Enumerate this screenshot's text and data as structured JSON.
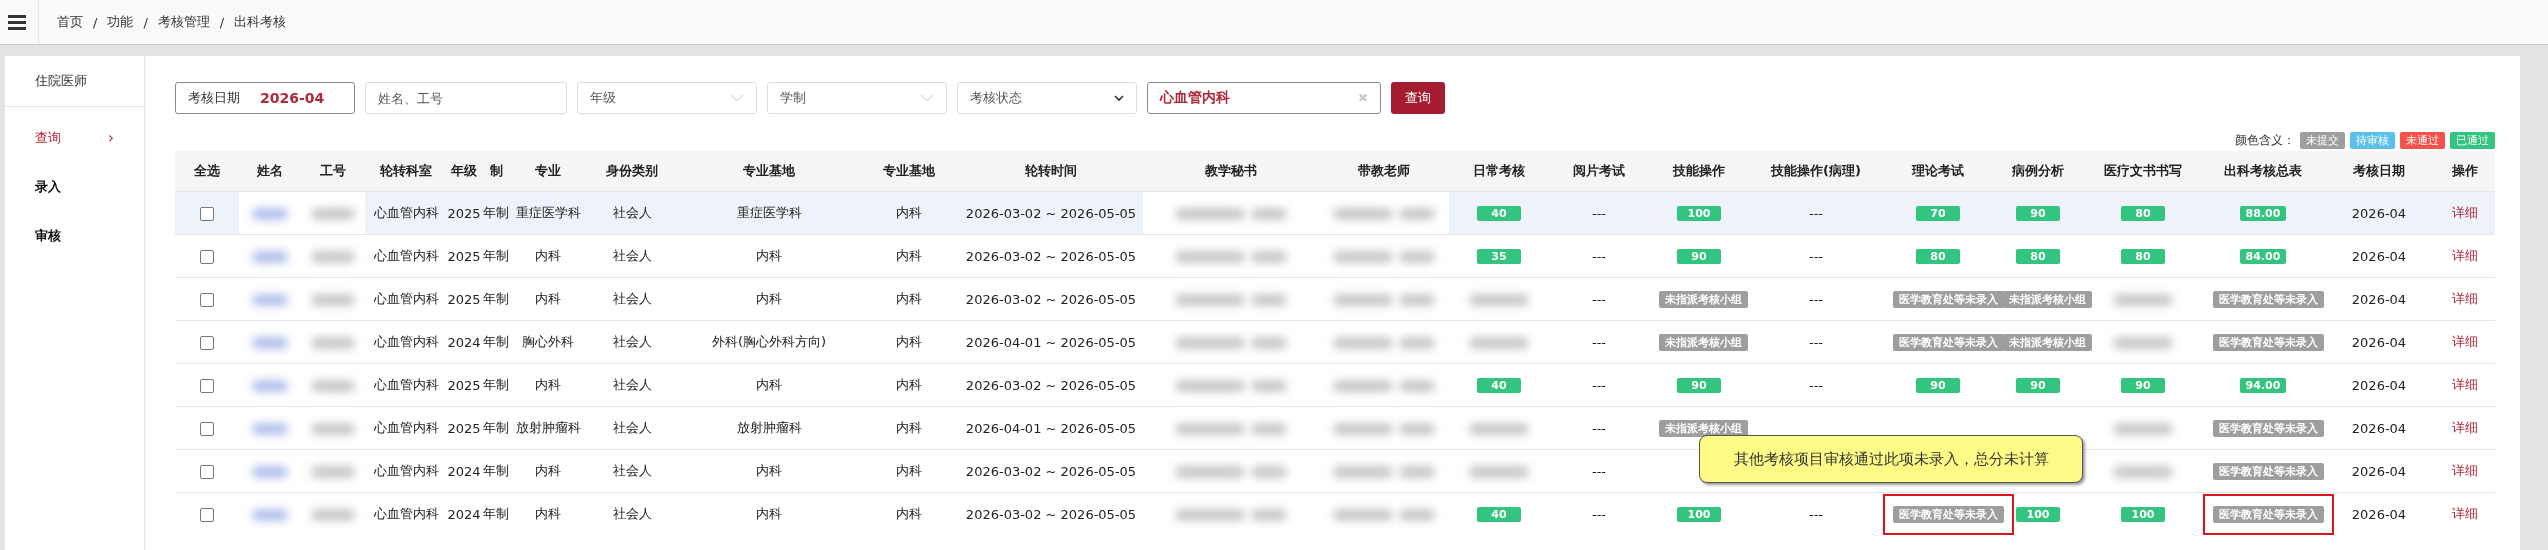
{
  "breadcrumb": {
    "items": [
      "首页",
      "功能",
      "考核管理",
      "出科考核"
    ],
    "separator": "/"
  },
  "sidebar": {
    "title": "住院医师",
    "items": [
      {
        "label": "查询",
        "selected": true,
        "arrow": "›"
      },
      {
        "label": "录入",
        "selected": false
      },
      {
        "label": "审核",
        "selected": false
      }
    ]
  },
  "filters": {
    "date": {
      "label": "考核日期",
      "value": "2026-04"
    },
    "name": {
      "placeholder": "姓名、工号"
    },
    "grade": {
      "placeholder": "年级"
    },
    "system": {
      "placeholder": "学制"
    },
    "status": {
      "placeholder": "考核状态"
    },
    "dept": {
      "value": "心血管内科",
      "clear": "✖"
    },
    "button": "查询"
  },
  "legend": {
    "label": "颜色含义：",
    "items": [
      {
        "label": "未提交",
        "color": "#9e9e9e"
      },
      {
        "label": "待审核",
        "color": "#5bc0eb"
      },
      {
        "label": "未通过",
        "color": "#f5534b"
      },
      {
        "label": "已通过",
        "color": "#33c47f"
      }
    ]
  },
  "table": {
    "columns": [
      "全选",
      "姓名",
      "工号",
      "轮转科室",
      "年级",
      "制",
      "专业",
      "身份类别",
      "专业基地",
      "专业基地",
      "轮转时间",
      "教学秘书",
      "带教老师",
      "日常考核",
      "阅片考试",
      "技能操作",
      "技能操作(病理)",
      "理论考试",
      "病例分析",
      "医疗文书书写",
      "出科考核总表",
      "考核日期",
      "操作"
    ],
    "rows": [
      {
        "hovered": true,
        "checked": false,
        "dept": "心血管内科",
        "grade": "2025",
        "system": "年制",
        "major": "重症医学科",
        "identity": "社会人",
        "base": "重症医学科",
        "base2": "内科",
        "period": "2026-03-02 ~ 2026-05-05",
        "scores": [
          {
            "kind": "badge",
            "text": "40",
            "color": "#33c47f",
            "outlined": false
          },
          {
            "kind": "dash",
            "text": "---"
          },
          {
            "kind": "badge",
            "text": "100",
            "color": "#33c47f",
            "outlined": false
          },
          {
            "kind": "dash",
            "text": "---"
          },
          {
            "kind": "badge",
            "text": "70",
            "color": "#33c47f",
            "outlined": false
          },
          {
            "kind": "badge",
            "text": "90",
            "color": "#33c47f",
            "outlined": false
          },
          {
            "kind": "badge",
            "text": "80",
            "color": "#33c47f",
            "outlined": false
          },
          {
            "kind": "badge",
            "text": "88.00",
            "color": "#33c47f",
            "outlined": false
          }
        ],
        "date": "2026-04",
        "action": "详细"
      },
      {
        "hovered": false,
        "checked": false,
        "dept": "心血管内科",
        "grade": "2025",
        "system": "年制",
        "major": "内科",
        "identity": "社会人",
        "base": "内科",
        "base2": "内科",
        "period": "2026-03-02 ~ 2026-05-05",
        "scores": [
          {
            "kind": "badge",
            "text": "35",
            "color": "#33c47f",
            "outlined": false
          },
          {
            "kind": "dash",
            "text": "---"
          },
          {
            "kind": "badge",
            "text": "90",
            "color": "#33c47f",
            "outlined": false
          },
          {
            "kind": "dash",
            "text": "---"
          },
          {
            "kind": "badge",
            "text": "80",
            "color": "#33c47f",
            "outlined": false
          },
          {
            "kind": "badge",
            "text": "80",
            "color": "#33c47f",
            "outlined": false
          },
          {
            "kind": "badge",
            "text": "80",
            "color": "#33c47f",
            "outlined": false
          },
          {
            "kind": "badge",
            "text": "84.00",
            "color": "#33c47f",
            "outlined": false
          }
        ],
        "date": "2026-04",
        "action": "详细"
      },
      {
        "hovered": false,
        "checked": false,
        "dept": "心血管内科",
        "grade": "2025",
        "system": "年制",
        "major": "内科",
        "identity": "社会人",
        "base": "内科",
        "base2": "内科",
        "period": "2026-03-02 ~ 2026-05-05",
        "scores": [
          {
            "kind": "blurred"
          },
          {
            "kind": "dash",
            "text": "---"
          },
          {
            "kind": "badge",
            "text": "未指派考核小组",
            "color": "#9e9e9e",
            "outlined": false
          },
          {
            "kind": "dash",
            "text": "---"
          },
          {
            "kind": "badge",
            "text": "医学教育处等未录入",
            "color": "#9e9e9e",
            "outlined": false
          },
          {
            "kind": "badge",
            "text": "未指派考核小组",
            "color": "#9e9e9e",
            "outlined": false
          },
          {
            "kind": "blurred"
          },
          {
            "kind": "badge",
            "text": "医学教育处等未录入",
            "color": "#9e9e9e",
            "outlined": false
          }
        ],
        "date": "2026-04",
        "action": "详细"
      },
      {
        "hovered": false,
        "checked": false,
        "dept": "心血管内科",
        "grade": "2024",
        "system": "年制",
        "major": "胸心外科",
        "identity": "社会人",
        "base": "外科(胸心外科方向)",
        "base2": "内科",
        "period": "2026-04-01 ~ 2026-05-05",
        "scores": [
          {
            "kind": "blurred"
          },
          {
            "kind": "dash",
            "text": "---"
          },
          {
            "kind": "badge",
            "text": "未指派考核小组",
            "color": "#9e9e9e",
            "outlined": false
          },
          {
            "kind": "dash",
            "text": "---"
          },
          {
            "kind": "badge",
            "text": "医学教育处等未录入",
            "color": "#9e9e9e",
            "outlined": false
          },
          {
            "kind": "badge",
            "text": "未指派考核小组",
            "color": "#9e9e9e",
            "outlined": false
          },
          {
            "kind": "blurred"
          },
          {
            "kind": "badge",
            "text": "医学教育处等未录入",
            "color": "#9e9e9e",
            "outlined": false
          }
        ],
        "date": "2026-04",
        "action": "详细"
      },
      {
        "hovered": false,
        "checked": false,
        "dept": "心血管内科",
        "grade": "2025",
        "system": "年制",
        "major": "内科",
        "identity": "社会人",
        "base": "内科",
        "base2": "内科",
        "period": "2026-03-02 ~ 2026-05-05",
        "scores": [
          {
            "kind": "badge",
            "text": "40",
            "color": "#33c47f",
            "outlined": false
          },
          {
            "kind": "dash",
            "text": "---"
          },
          {
            "kind": "badge",
            "text": "90",
            "color": "#33c47f",
            "outlined": false
          },
          {
            "kind": "dash",
            "text": "---"
          },
          {
            "kind": "badge",
            "text": "90",
            "color": "#33c47f",
            "outlined": false
          },
          {
            "kind": "badge",
            "text": "90",
            "color": "#33c47f",
            "outlined": false
          },
          {
            "kind": "badge",
            "text": "90",
            "color": "#33c47f",
            "outlined": false
          },
          {
            "kind": "badge",
            "text": "94.00",
            "color": "#33c47f",
            "outlined": false
          }
        ],
        "date": "2026-04",
        "action": "详细"
      },
      {
        "hovered": false,
        "checked": false,
        "dept": "心血管内科",
        "grade": "2025",
        "system": "年制",
        "major": "放射肿瘤科",
        "identity": "社会人",
        "base": "放射肿瘤科",
        "base2": "内科",
        "period": "2026-04-01 ~ 2026-05-05",
        "scores": [
          {
            "kind": "blurred"
          },
          {
            "kind": "dash",
            "text": "---"
          },
          {
            "kind": "badge",
            "text": "未指派考核小组",
            "color": "#9e9e9e",
            "outlined": false
          },
          {
            "kind": "covered"
          },
          {
            "kind": "covered"
          },
          {
            "kind": "covered"
          },
          {
            "kind": "blurred"
          },
          {
            "kind": "badge",
            "text": "医学教育处等未录入",
            "color": "#9e9e9e",
            "outlined": false
          }
        ],
        "date": "2026-04",
        "action": "详细"
      },
      {
        "hovered": false,
        "checked": false,
        "dept": "心血管内科",
        "grade": "2024",
        "system": "年制",
        "major": "内科",
        "identity": "社会人",
        "base": "内科",
        "base2": "内科",
        "period": "2026-03-02 ~ 2026-05-05",
        "scores": [
          {
            "kind": "blurred"
          },
          {
            "kind": "dash",
            "text": "---"
          },
          {
            "kind": "covered"
          },
          {
            "kind": "covered"
          },
          {
            "kind": "covered"
          },
          {
            "kind": "covered"
          },
          {
            "kind": "blurred"
          },
          {
            "kind": "badge",
            "text": "医学教育处等未录入",
            "color": "#9e9e9e",
            "outlined": false
          }
        ],
        "date": "2026-04",
        "action": "详细"
      },
      {
        "hovered": false,
        "checked": false,
        "dept": "心血管内科",
        "grade": "2024",
        "system": "年制",
        "major": "内科",
        "identity": "社会人",
        "base": "内科",
        "base2": "内科",
        "period": "2026-03-02 ~ 2026-05-05",
        "scores": [
          {
            "kind": "badge",
            "text": "40",
            "color": "#33c47f",
            "outlined": false
          },
          {
            "kind": "dash",
            "text": "---"
          },
          {
            "kind": "badge",
            "text": "100",
            "color": "#33c47f",
            "outlined": false
          },
          {
            "kind": "dash",
            "text": "---"
          },
          {
            "kind": "badge",
            "text": "医学教育处等未录入",
            "color": "#9e9e9e",
            "outlined": true
          },
          {
            "kind": "badge",
            "text": "100",
            "color": "#33c47f",
            "outlined": false
          },
          {
            "kind": "badge",
            "text": "100",
            "color": "#33c47f",
            "outlined": false
          },
          {
            "kind": "badge",
            "text": "医学教育处等未录入",
            "color": "#9e9e9e",
            "outlined": true
          }
        ],
        "date": "2026-04",
        "action": "详细"
      }
    ]
  },
  "tooltip": {
    "text": "其他考核项目审核通过此项未录入，总分未计算"
  }
}
